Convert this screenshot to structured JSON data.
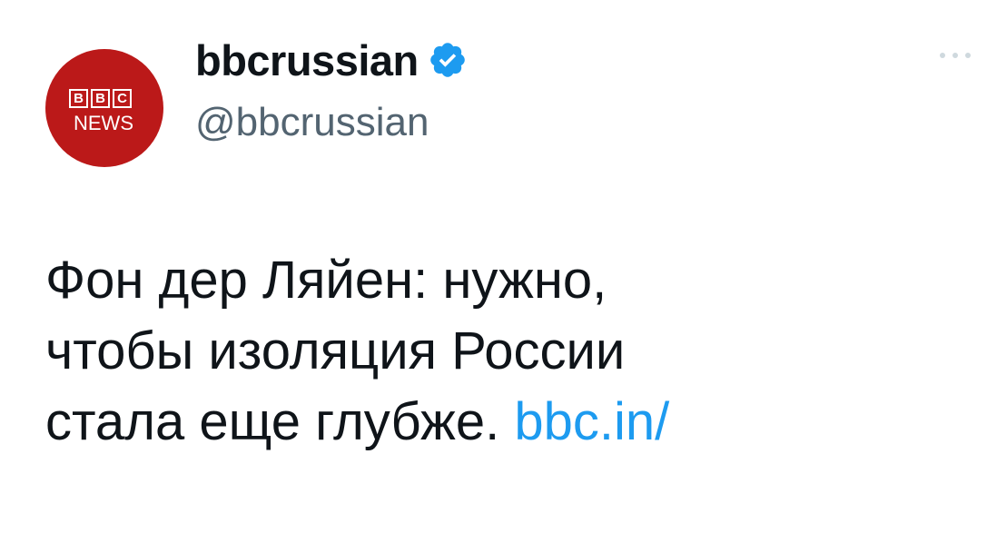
{
  "author": {
    "avatar": {
      "logo_text": "BBC",
      "logo_letters": [
        "B",
        "B",
        "C"
      ],
      "logo_subtext": "NEWS",
      "background_color": "#bb1919"
    },
    "display_name": "bbcrussian",
    "verified_icon": "verified-badge-icon",
    "verified_color": "#1d9bf0",
    "handle": "@bbcrussian"
  },
  "menu": {
    "icon": "more-options-icon"
  },
  "tweet": {
    "text_lines": [
      "Фон дер Ляйен: нужно,",
      "чтобы изоляция России",
      "стала еще глубже."
    ],
    "link_text": "bbc.in/",
    "link_color": "#1d9bf0"
  }
}
